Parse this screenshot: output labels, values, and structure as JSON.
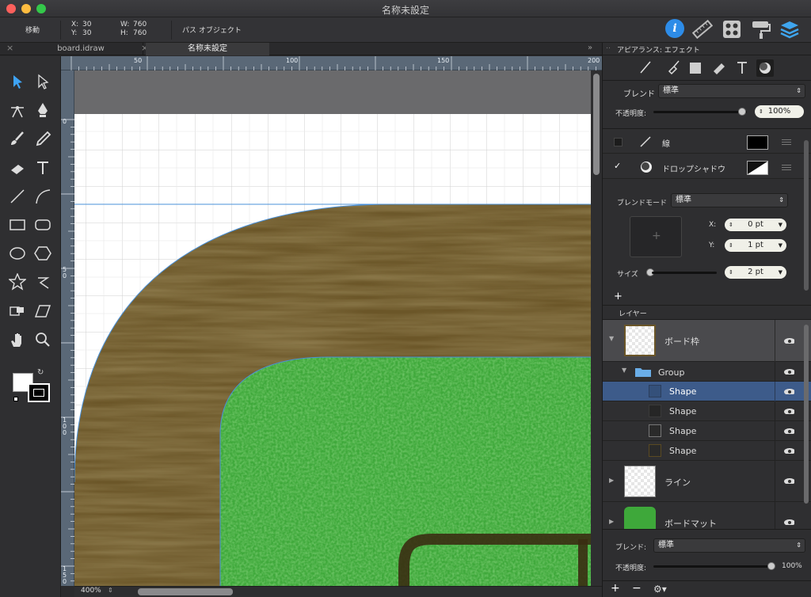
{
  "window": {
    "title": "名称未設定"
  },
  "toolbar": {
    "move_label": "移動",
    "x_label": "X:",
    "x_value": "30",
    "y_label": "Y:",
    "y_value": "30",
    "w_label": "W:",
    "w_value": "760",
    "h_label": "H:",
    "h_value": "760",
    "object_type": "パス オブジェクト"
  },
  "tabs": [
    {
      "label": "board.idraw"
    },
    {
      "label": "名称未設定"
    }
  ],
  "ruler_top": [
    "50",
    "100",
    "150",
    "200"
  ],
  "ruler_left": [
    "0",
    "5 0",
    "1 0 0",
    "1 5 0"
  ],
  "zoom": "400%",
  "panel": {
    "title": "アピアランス: エフェクト",
    "blend_label": "ブレンド",
    "blend_value": "標準",
    "opacity_label": "不透明度:",
    "opacity_value": "100%",
    "effects": [
      {
        "label": "線",
        "checked": false
      },
      {
        "label": "ドロップシャドウ",
        "checked": true
      }
    ],
    "blend_mode_label": "ブレンドモード",
    "blend_mode_value": "標準",
    "x_label": "X:",
    "x_value": "0 pt",
    "y_label": "Y:",
    "y_value": "1 pt",
    "size_label": "サイズ",
    "size_value": "2 pt",
    "add_label": "+",
    "layers_title": "レイヤー",
    "layers": [
      {
        "name": "ボード枠"
      },
      {
        "name": "Group"
      },
      {
        "name": "Shape",
        "selected": true
      },
      {
        "name": "Shape"
      },
      {
        "name": "Shape"
      },
      {
        "name": "Shape"
      },
      {
        "name": "ライン"
      },
      {
        "name": "ボードマット"
      }
    ],
    "bottom_blend_label": "ブレンド:",
    "bottom_blend_value": "標準",
    "bottom_opacity_label": "不透明度:",
    "bottom_opacity_value": "100%",
    "plus": "+",
    "minus": "−"
  },
  "colors": {
    "accent": "#4a90d9",
    "wood": "#6b5628",
    "felt": "#3ea83a",
    "selection": "#3d5b8a"
  }
}
